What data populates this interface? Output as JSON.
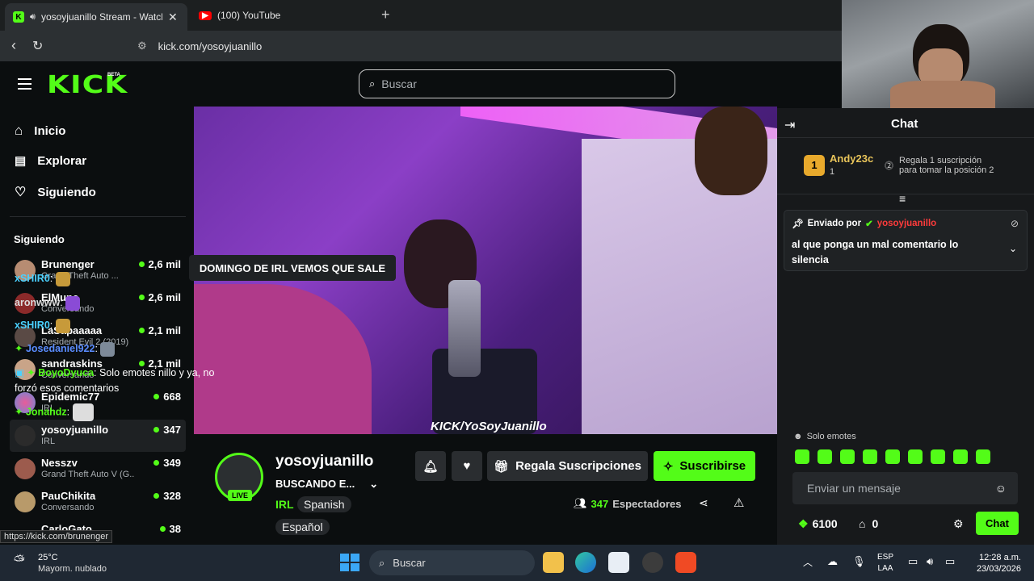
{
  "browser": {
    "tabs": [
      {
        "title": "yosoyjuanillo Stream - Watch",
        "active": true
      },
      {
        "title": "(100) YouTube",
        "active": false
      }
    ],
    "url": "kick.com/yosoyjuanillo",
    "status_url": "https://kick.com/brunenger"
  },
  "header": {
    "logo": "KICK",
    "logo_badge": "BETA",
    "search_placeholder": "Buscar"
  },
  "sidebar": {
    "nav": [
      {
        "label": "Inicio",
        "icon": "home-icon"
      },
      {
        "label": "Explorar",
        "icon": "explore-icon"
      },
      {
        "label": "Siguiendo",
        "icon": "heart-icon"
      }
    ],
    "section_title": "Siguiendo",
    "channels": [
      {
        "name": "Brunenger",
        "game": "Grand Theft Auto ...",
        "viewers": "2,6 mil"
      },
      {
        "name": "ElMune",
        "game": "Conversando",
        "viewers": "2,6 mil"
      },
      {
        "name": "LaSapaaaaa",
        "game": "Resident Evil 2 (2019)",
        "viewers": "2,1 mil"
      },
      {
        "name": "sandraskins",
        "game": "Conversando",
        "viewers": "2,1 mil"
      },
      {
        "name": "Epidemic77",
        "game": "IRL",
        "viewers": "668"
      },
      {
        "name": "yosoyjuanillo",
        "game": "IRL",
        "viewers": "347"
      },
      {
        "name": "Nesszv",
        "game": "Grand Theft Auto V (G...",
        "viewers": "349"
      },
      {
        "name": "PauChikita",
        "game": "Conversando",
        "viewers": "328"
      },
      {
        "name": "CarloGato",
        "game": "",
        "viewers": "38"
      }
    ]
  },
  "video": {
    "tooltip": "DOMINGO DE IRL VEMOS QUE SALE",
    "watermark": "KICK/YoSoyJuanillo"
  },
  "stream_info": {
    "channel_name": "yosoyjuanillo",
    "live_badge": "LIVE",
    "title": "BUSCANDO E...",
    "category": "IRL",
    "tags": [
      "Spanish",
      "Español"
    ],
    "gift_button": "Regala Suscripciones",
    "subscribe_button": "Suscribirse",
    "viewers": "347",
    "viewers_label": "Espectadores"
  },
  "chat": {
    "title": "Chat",
    "leader": {
      "rank": "1",
      "name": "Andy23c",
      "count": "1"
    },
    "gift_hint_line1": "Regala 1 suscripción",
    "gift_hint_line2": "para tomar la posición 2",
    "pinned": {
      "label": "Enviado por",
      "user": "yosoyjuanillo",
      "text": "al que ponga un mal comentario lo silencia"
    },
    "messages": [
      {
        "user": "xSHIR0",
        "text": ""
      },
      {
        "user": "aronwww",
        "text": ""
      },
      {
        "user": "xSHIR0",
        "text": ""
      },
      {
        "user": "Josedaniel922",
        "text": ""
      },
      {
        "user": "BoyoDyuca",
        "text": "Solo emotes nillo y ya, no forzó esos comentarios"
      },
      {
        "user": "Jonahdz",
        "text": ""
      }
    ],
    "emote_only": "Solo emotes",
    "input_placeholder": "Enviar un mensaje",
    "points": "6100",
    "drops": "0",
    "send_button": "Chat"
  },
  "taskbar": {
    "weather_temp": "25°C",
    "weather_desc": "Mayorm. nublado",
    "search": "Buscar",
    "lang": "ESP",
    "layout": "LAA",
    "time": "12:28 a.m.",
    "date": "23/03/2026"
  },
  "colors": {
    "kick_green": "#53fc18",
    "background": "#0b0e0f",
    "chat_bg": "#17191b"
  }
}
